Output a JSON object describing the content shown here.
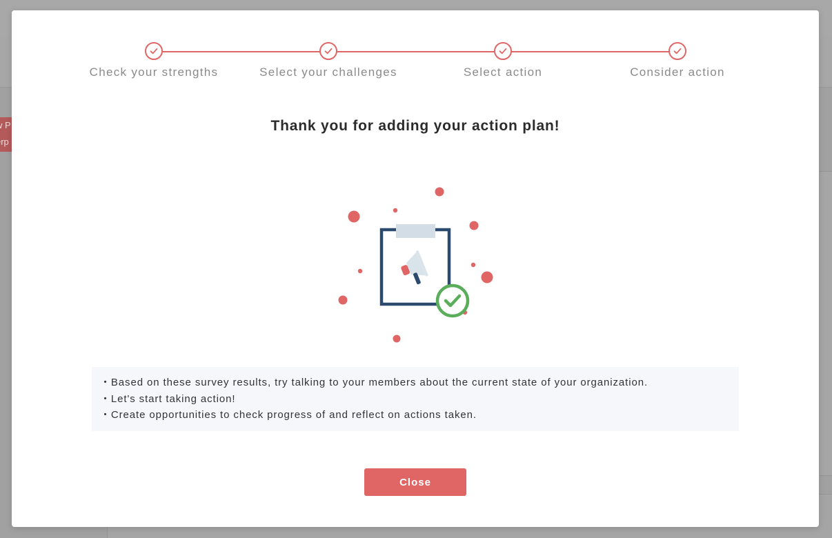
{
  "background": {
    "tag_lines": [
      "w P",
      "erp"
    ]
  },
  "stepper": {
    "steps": [
      {
        "label": "Check your strengths",
        "completed": true
      },
      {
        "label": "Select your challenges",
        "completed": true
      },
      {
        "label": "Select action",
        "completed": true
      },
      {
        "label": "Consider action",
        "completed": true
      }
    ],
    "step_icon": "check-icon"
  },
  "modal": {
    "title": "Thank you for adding your action plan!",
    "illustration_icon": "clipboard-megaphone-check-icon",
    "messages": [
      "・Based on these survey results, try talking to your members about the current state of your organization.",
      "・Let's start taking action!",
      "・Create opportunities to check progress of and reflect on actions taken."
    ],
    "close_label": "Close"
  },
  "colors": {
    "accent": "#e06666",
    "success": "#5aad5a",
    "navy": "#2b4a6e",
    "overlay": "#a3a3a3",
    "message_bg": "#f5f7fb"
  }
}
